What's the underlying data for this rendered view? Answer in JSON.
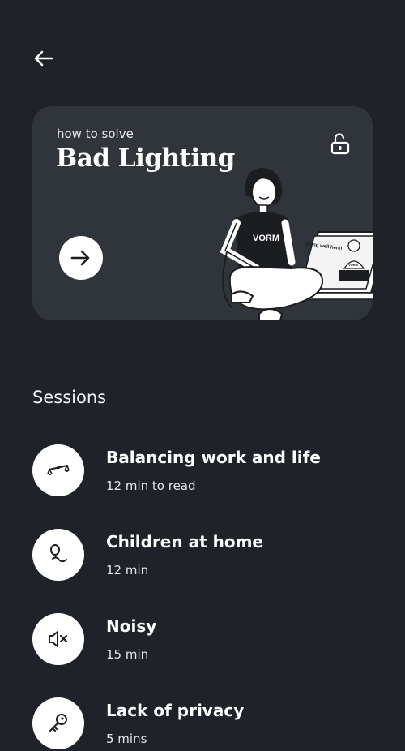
{
  "colors": {
    "background": "#1f2329",
    "card": "#30343b",
    "icon_bg": "#ffffff",
    "text": "#ffffff"
  },
  "header": {
    "back_icon": "arrow-left-icon"
  },
  "hero": {
    "kicker": "how to solve",
    "title": "Bad Lighting",
    "lock_icon": "unlock-icon",
    "start_icon": "arrow-right-icon",
    "illustration": {
      "shirt_text": "VORM",
      "screen_text": "going well here!",
      "screen_shirt_text": "VORM"
    }
  },
  "sessions": {
    "heading": "Sessions",
    "items": [
      {
        "title": "Balancing work and life",
        "meta": "12 min to read",
        "icon": "scale-icon"
      },
      {
        "title": "Children at home",
        "meta": "12 min",
        "icon": "pacifier-icon"
      },
      {
        "title": "Noisy",
        "meta": "15 min",
        "icon": "mute-icon"
      },
      {
        "title": "Lack of privacy",
        "meta": "5 mins",
        "icon": "key-icon"
      }
    ]
  }
}
